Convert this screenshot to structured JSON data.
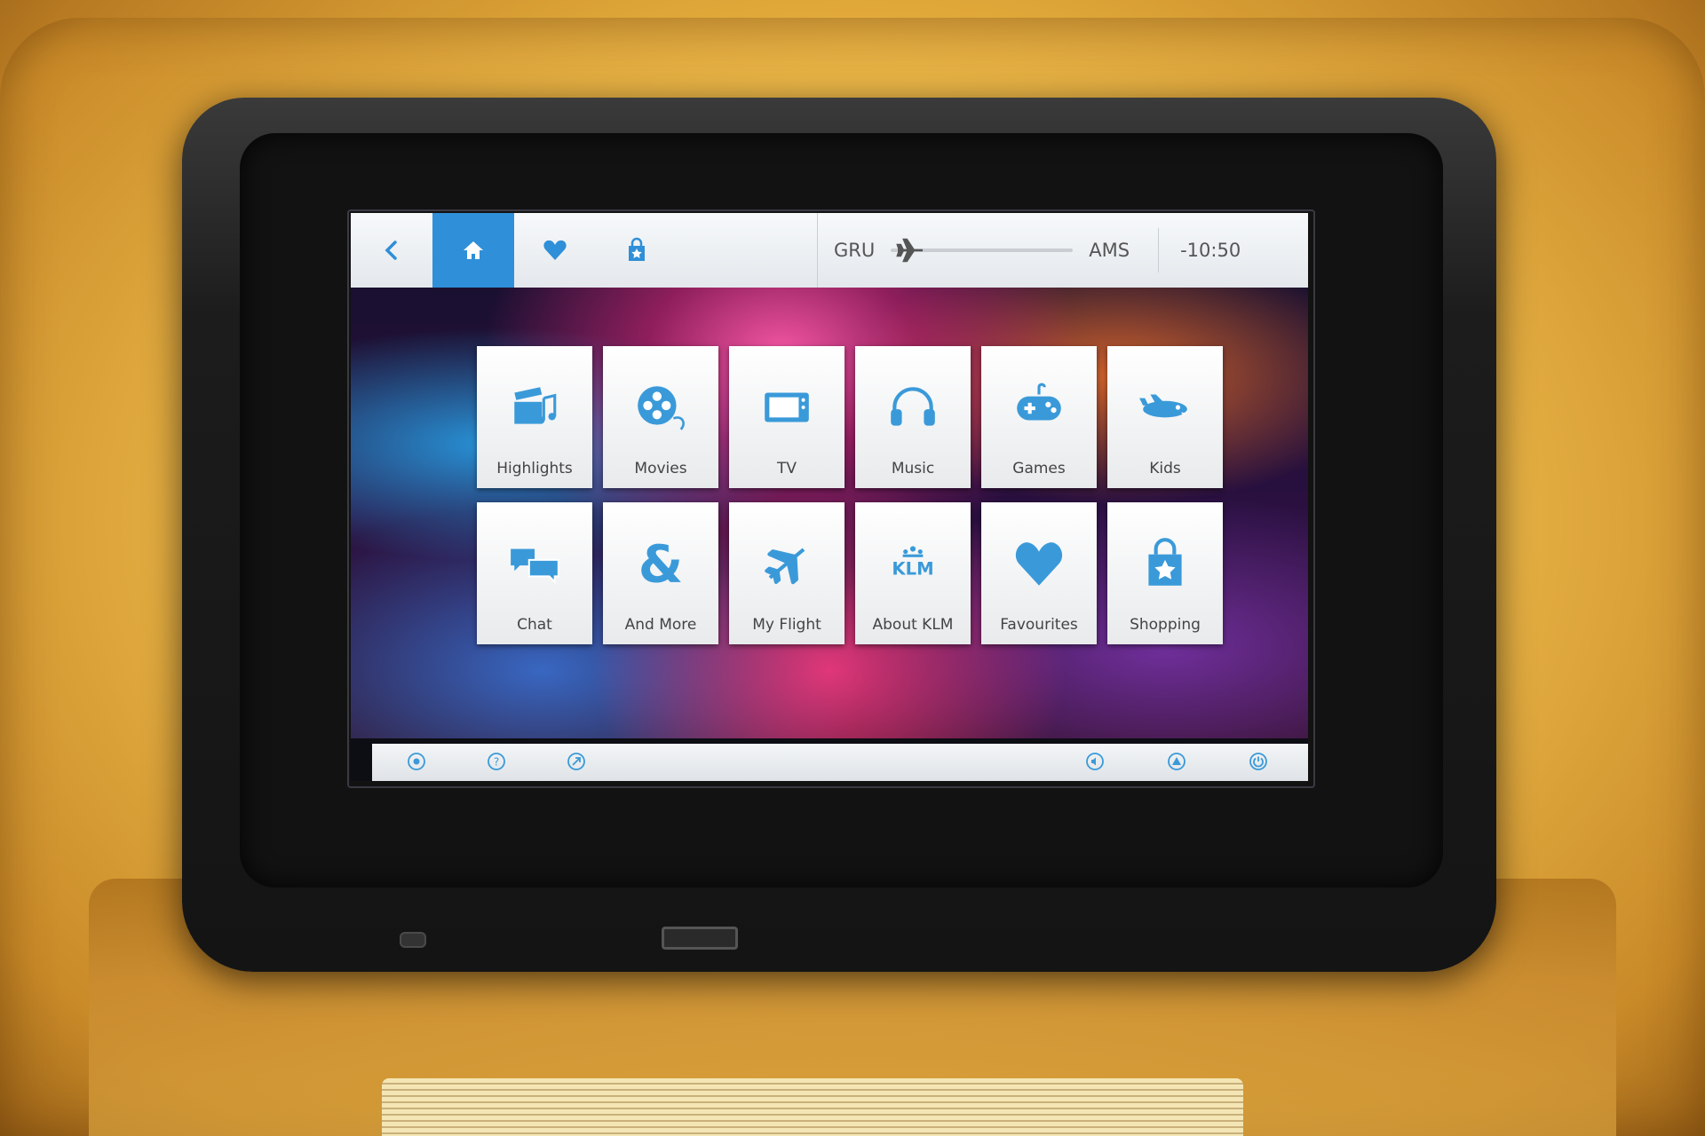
{
  "topbar": {
    "origin": "GRU",
    "destination": "AMS",
    "time_remaining": "-10:50",
    "flight_progress": 0.05,
    "icons": [
      "back-chevron-icon",
      "home-icon",
      "heart-icon",
      "shopping-bag-icon"
    ]
  },
  "tiles": [
    {
      "label": "Highlights",
      "icon": "clapperboard-music-icon"
    },
    {
      "label": "Movies",
      "icon": "film-reel-icon"
    },
    {
      "label": "TV",
      "icon": "tv-icon"
    },
    {
      "label": "Music",
      "icon": "headphones-icon"
    },
    {
      "label": "Games",
      "icon": "gamepad-icon"
    },
    {
      "label": "Kids",
      "icon": "cartoon-plane-icon"
    },
    {
      "label": "Chat",
      "icon": "chat-bubbles-icon"
    },
    {
      "label": "And More",
      "icon": "ampersand-icon"
    },
    {
      "label": "My Flight",
      "icon": "airplane-icon"
    },
    {
      "label": "About KLM",
      "icon": "klm-logo-icon"
    },
    {
      "label": "Favourites",
      "icon": "heart-icon"
    },
    {
      "label": "Shopping",
      "icon": "shopping-bag-star-icon"
    }
  ],
  "bottombar": {
    "left_icons": [
      "settings-icon",
      "help-icon",
      "flight-compass-icon"
    ],
    "right_icons": [
      "volume-icon",
      "brightness-icon",
      "power-icon"
    ]
  },
  "colors": {
    "accent": "#2f8fd8",
    "icon_blue": "#3a9ad9",
    "bar_bg": "#eef1f4"
  }
}
